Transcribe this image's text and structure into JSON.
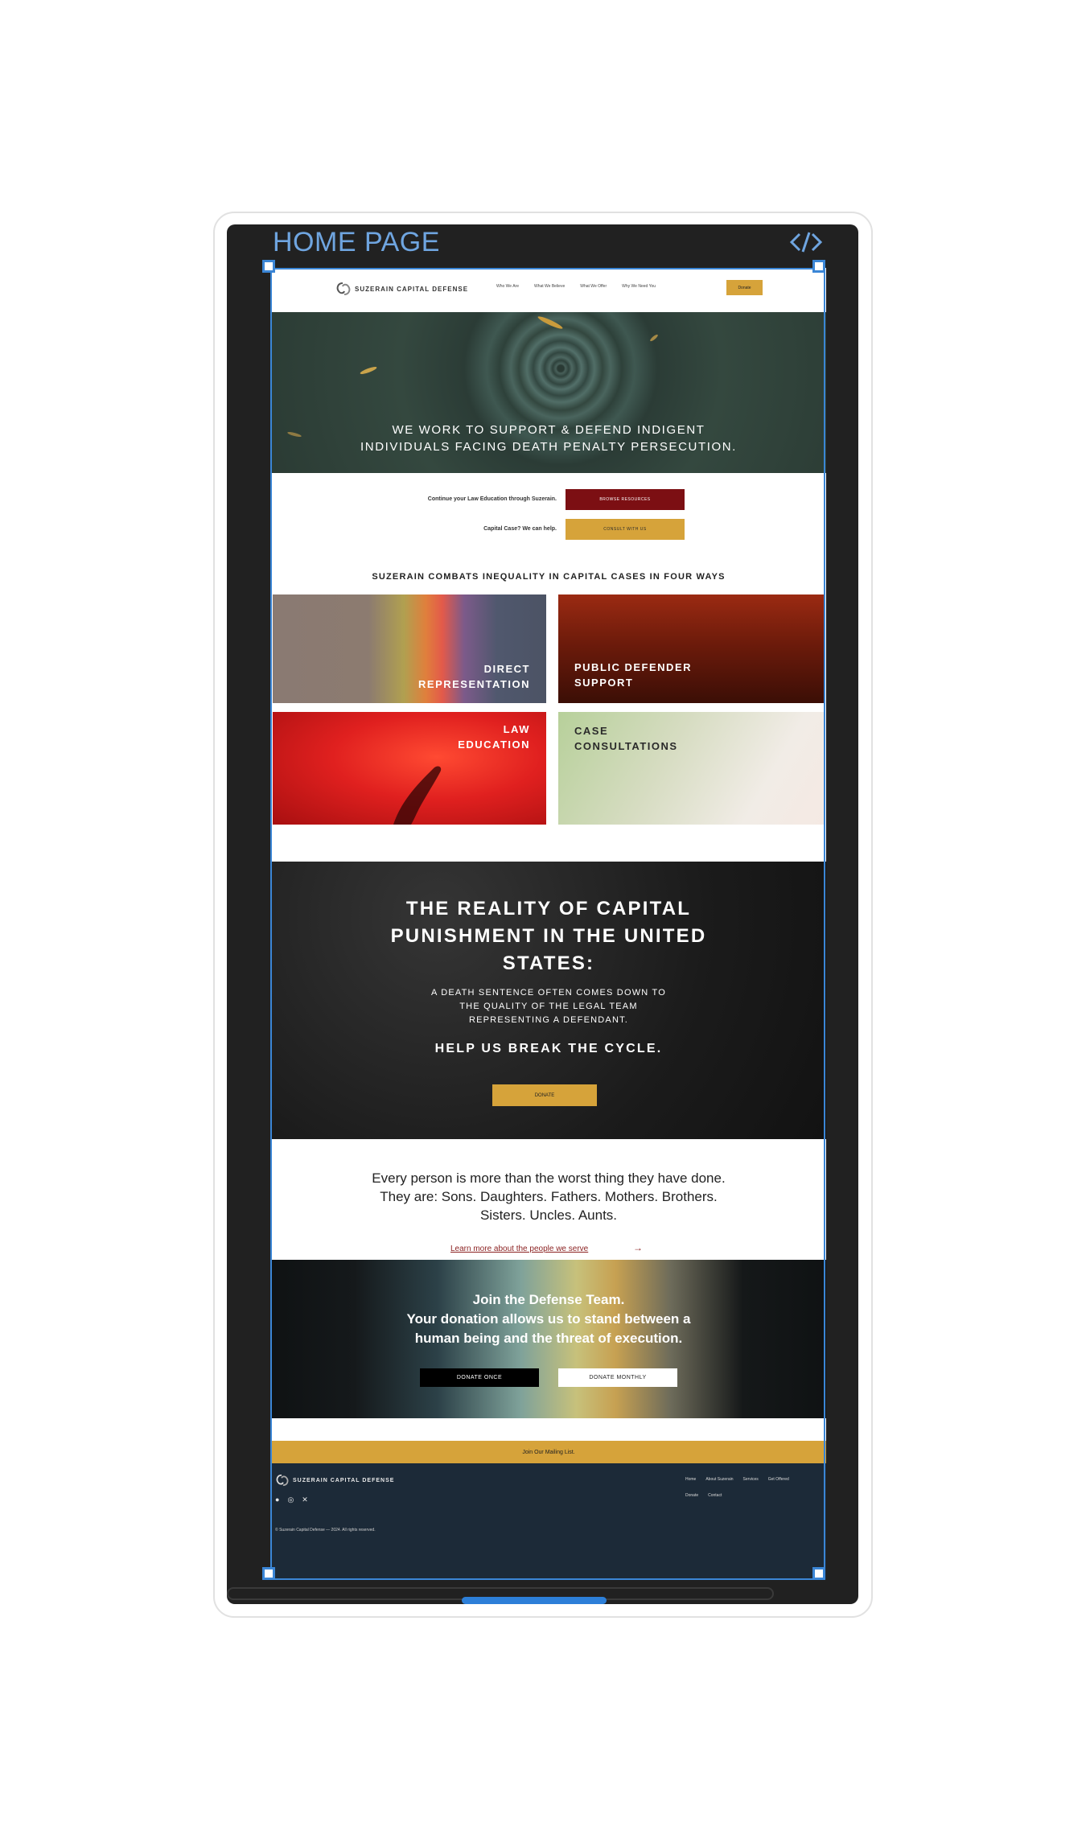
{
  "frame": {
    "title": "HOME PAGE",
    "code_icon": "code-icon"
  },
  "nav": {
    "logo_text": "SUZERAIN CAPITAL DEFENSE",
    "links": [
      "Who We Are",
      "What We Believe",
      "What We Offer",
      "Why We Need You"
    ],
    "donate": "Donate"
  },
  "hero": {
    "line1": "WE WORK TO SUPPORT & DEFEND INDIGENT",
    "line2": "INDIVIDUALS FACING DEATH PENALTY PERSECUTION."
  },
  "resources": {
    "label1": "Continue your Law Education through Suzerain.",
    "button1": "BROWSE RESOURCES",
    "label2": "Capital Case? We can help.",
    "button2": "CONSULT WITH US"
  },
  "ways": {
    "heading": "SUZERAIN COMBATS INEQUALITY IN CAPITAL CASES IN FOUR WAYS",
    "cards": [
      {
        "line1": "DIRECT",
        "line2": "REPRESENTATION"
      },
      {
        "line1": "PUBLIC DEFENDER",
        "line2": "SUPPORT"
      },
      {
        "line1": "LAW",
        "line2": "EDUCATION"
      },
      {
        "line1": "CASE",
        "line2": "CONSULTATIONS"
      }
    ]
  },
  "reality": {
    "title1": "THE REALITY OF CAPITAL",
    "title2": "PUNISHMENT IN THE UNITED",
    "title3": "STATES:",
    "sub1": "A DEATH SENTENCE OFTEN COMES DOWN TO",
    "sub2": "THE QUALITY OF THE LEGAL TEAM",
    "sub3": "REPRESENTING A DEFENDANT.",
    "cta": "HELP US BREAK THE CYCLE.",
    "donate": "DONATE"
  },
  "person": {
    "line1": "Every person is more than the worst thing they have done.",
    "line2": "They are: Sons. Daughters. Fathers. Mothers. Brothers.",
    "line3": "Sisters. Uncles. Aunts.",
    "link": "Learn more about the people we serve",
    "arrow": "→"
  },
  "join": {
    "line1": "Join the Defense Team.",
    "line2": "Your donation allows us to stand between a",
    "line3": "human being and the threat of execution.",
    "donate_once": "DONATE ONCE",
    "donate_monthly": "DONATE MONTHLY"
  },
  "mailing": "Join Our Mailing List.",
  "footer": {
    "logo_text": "SUZERAIN CAPITAL DEFENSE",
    "social": [
      "facebook-icon",
      "instagram-icon",
      "x-icon"
    ],
    "links_row1": [
      "Home",
      "About Suzerain",
      "Services",
      "Get Offered"
    ],
    "links_row2": [
      "Donate",
      "Contact"
    ],
    "copyright": "© Suzerain Capital Defense — 2024. All rights reserved."
  },
  "colors": {
    "gold": "#d6a33a",
    "maroon": "#7c0f13",
    "footer": "#1c2a38",
    "selection": "#3b86d6"
  }
}
